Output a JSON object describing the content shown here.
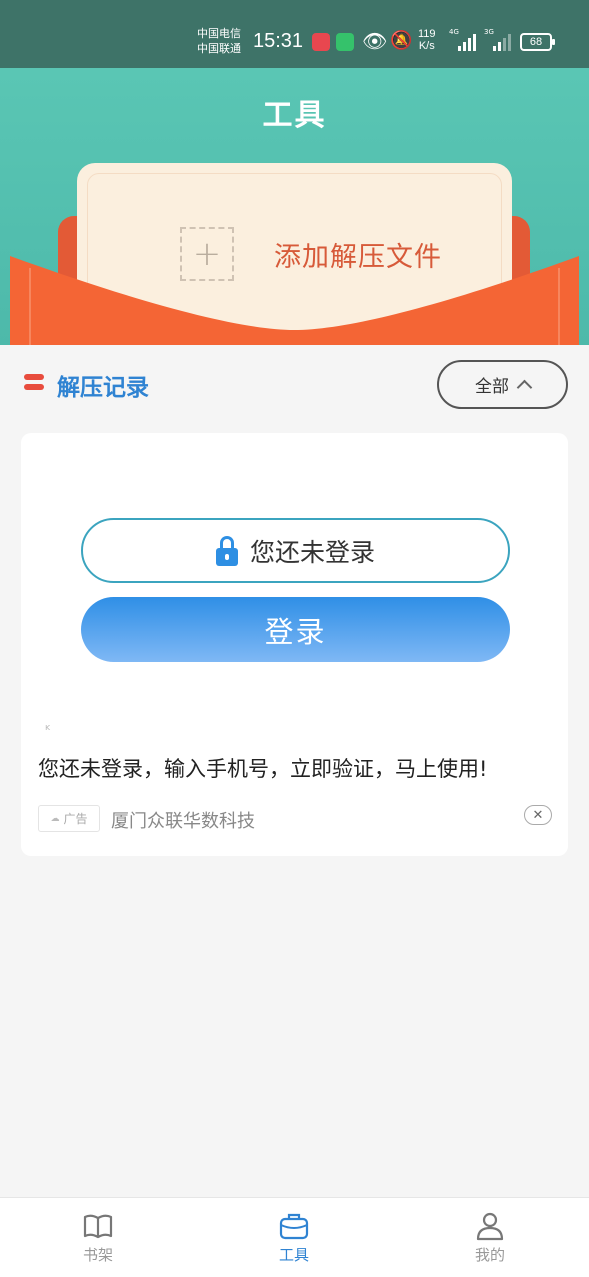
{
  "status_bar": {
    "carrier_1": "中国电信",
    "carrier_2": "中国联通",
    "time": "15:31",
    "net_speed_value": "119",
    "net_speed_unit": "K/s",
    "signal_1": "4G",
    "signal_2": "3G",
    "battery": "68"
  },
  "header": {
    "title": "工具",
    "add_file_label": "添加解压文件",
    "add_icon": "plus-icon"
  },
  "section": {
    "title": "解压记录",
    "filter_label": "全部"
  },
  "ad": {
    "login_status": "您还未登录",
    "login_button": "登录",
    "tiny_mark": "ĸ",
    "body_text": "您还未登录，输入手机号，立即验证，马上使用!",
    "badge": "广告",
    "source": "厦门众联华数科技",
    "close_symbol": "✕"
  },
  "bottom_nav": {
    "items": [
      {
        "label": "书架",
        "icon": "book-icon"
      },
      {
        "label": "工具",
        "icon": "toolbox-icon"
      },
      {
        "label": "我的",
        "icon": "person-icon"
      }
    ]
  },
  "colors": {
    "header_teal": "#5ac6b4",
    "envelope_orange": "#f46535",
    "card_cream": "#fbefde",
    "accent_blue": "#2f83d2"
  }
}
